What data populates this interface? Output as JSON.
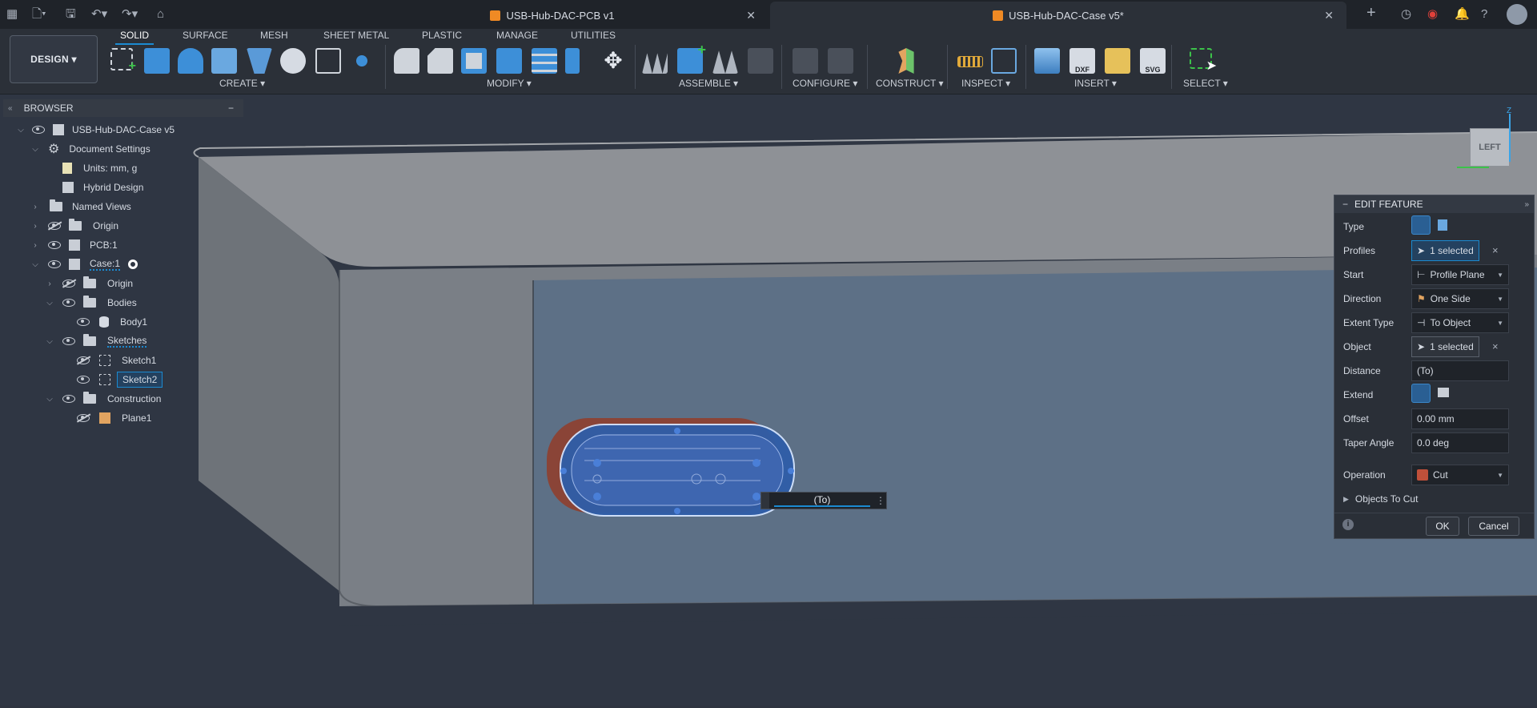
{
  "titlebar": {
    "tabs": [
      {
        "title": "USB-Hub-DAC-PCB v1",
        "active": false
      },
      {
        "title": "USB-Hub-DAC-Case v5*",
        "active": true
      }
    ],
    "close_glyph": "✕",
    "new_tab_glyph": "+"
  },
  "ribbon": {
    "workspace": "DESIGN",
    "tabs": [
      "SOLID",
      "SURFACE",
      "MESH",
      "SHEET METAL",
      "PLASTIC",
      "MANAGE",
      "UTILITIES"
    ],
    "active_tab": "SOLID",
    "groups": [
      "CREATE",
      "MODIFY",
      "ASSEMBLE",
      "CONFIGURE",
      "CONSTRUCT",
      "INSPECT",
      "INSERT",
      "SELECT"
    ],
    "insert_labels": {
      "dxf": "DXF",
      "svg": "SVG"
    }
  },
  "browser": {
    "title": "BROWSER",
    "collapse": "−",
    "items": [
      {
        "label": "USB-Hub-DAC-Case v5",
        "icon": "component-icon"
      },
      {
        "label": "Document Settings",
        "icon": "gear-icon"
      },
      {
        "label": "Units: mm, g",
        "icon": "document-icon"
      },
      {
        "label": "Hybrid Design",
        "icon": "hybrid-icon"
      },
      {
        "label": "Named Views",
        "icon": "folder-icon"
      },
      {
        "label": "Origin",
        "icon": "folder-icon"
      },
      {
        "label": "PCB:1",
        "icon": "component-icon"
      },
      {
        "label": "Case:1",
        "icon": "component-icon"
      },
      {
        "label": "Origin",
        "icon": "folder-icon"
      },
      {
        "label": "Bodies",
        "icon": "folder-icon"
      },
      {
        "label": "Body1",
        "icon": "body-icon"
      },
      {
        "label": "Sketches",
        "icon": "folder-icon"
      },
      {
        "label": "Sketch1",
        "icon": "sketch-icon"
      },
      {
        "label": "Sketch2",
        "icon": "sketch-icon"
      },
      {
        "label": "Construction",
        "icon": "folder-icon"
      },
      {
        "label": "Plane1",
        "icon": "plane-icon"
      }
    ]
  },
  "viewcube": {
    "face": "LEFT",
    "axis": "Z"
  },
  "distance_input": {
    "value": "(To)"
  },
  "edit_feature": {
    "title": "EDIT FEATURE",
    "rows": {
      "type": "Type",
      "profiles": "Profiles",
      "profiles_value": "1 selected",
      "start": "Start",
      "start_value": "Profile Plane",
      "direction": "Direction",
      "direction_value": "One Side",
      "extent_type": "Extent Type",
      "extent_value": "To Object",
      "object": "Object",
      "object_value": "1 selected",
      "distance": "Distance",
      "distance_value": "(To)",
      "extend": "Extend",
      "offset": "Offset",
      "offset_value": "0.00 mm",
      "taper": "Taper Angle",
      "taper_value": "0.0 deg",
      "operation": "Operation",
      "operation_value": "Cut",
      "objects_to_cut": "Objects To Cut"
    },
    "ok": "OK",
    "cancel": "Cancel",
    "info_glyph": "i",
    "clear_glyph": "×"
  },
  "colors": {
    "accent": "#1b8ad1",
    "highlight": "#2f5ea8",
    "cut": "#b5442c"
  }
}
